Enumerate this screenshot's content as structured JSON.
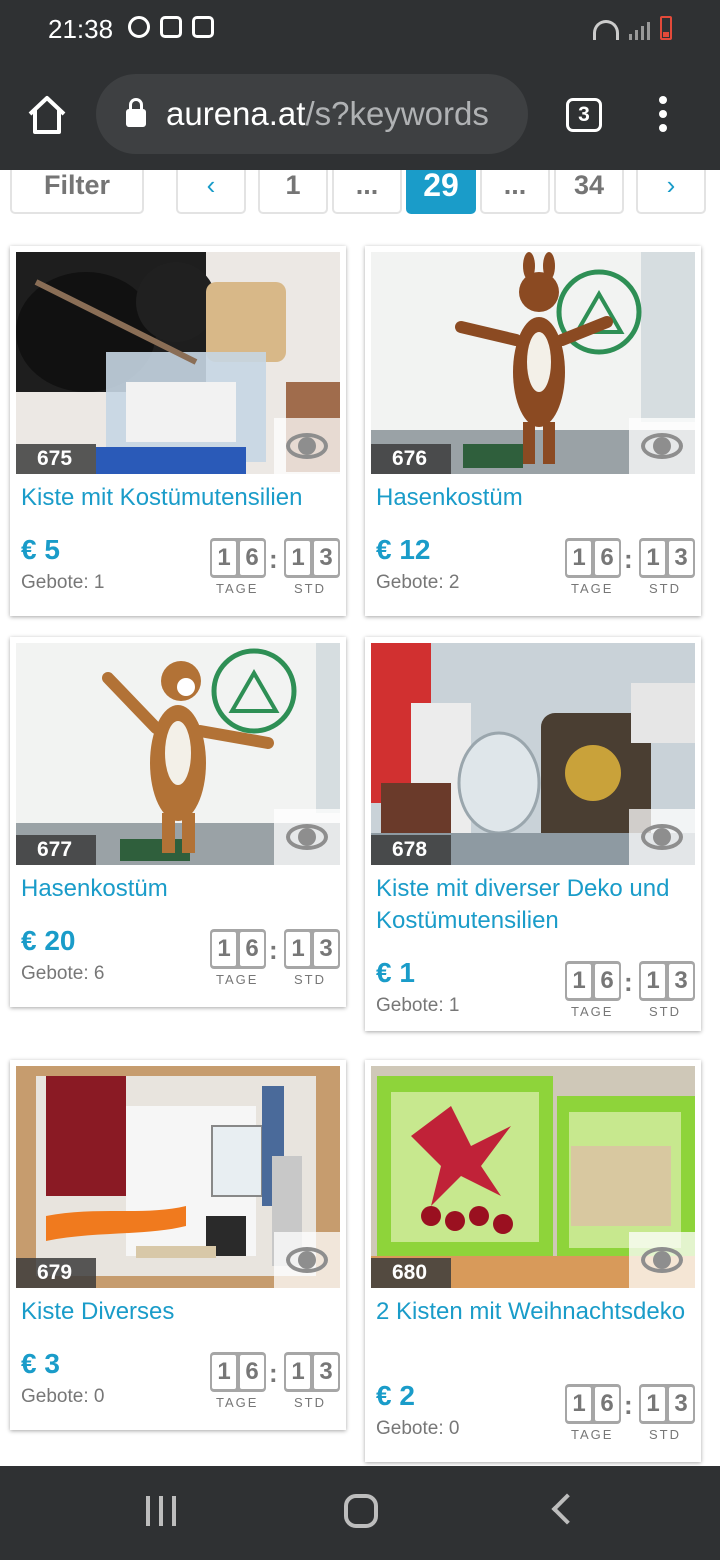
{
  "status_bar": {
    "time": "21:38"
  },
  "browser": {
    "url_domain": "aurena.at",
    "url_path": "/s?keywords",
    "tab_count": "3"
  },
  "pagination": {
    "filter_label": "Filter",
    "prev": "‹",
    "pages": [
      "1",
      "...",
      "29",
      "...",
      "34"
    ],
    "current": "29",
    "next": "›"
  },
  "timer_labels": {
    "days": "TAGE",
    "hours": "STD"
  },
  "cards": [
    {
      "lot": "675",
      "title": "Kiste mit Kostümutensilien",
      "price": "€ 5",
      "bids": "Gebote: 1",
      "days": [
        "1",
        "6"
      ],
      "hours": [
        "1",
        "3"
      ]
    },
    {
      "lot": "676",
      "title": "Hasenkostüm",
      "price": "€ 12",
      "bids": "Gebote: 2",
      "days": [
        "1",
        "6"
      ],
      "hours": [
        "1",
        "3"
      ]
    },
    {
      "lot": "677",
      "title": "Hasenkostüm",
      "price": "€ 20",
      "bids": "Gebote: 6",
      "days": [
        "1",
        "6"
      ],
      "hours": [
        "1",
        "3"
      ]
    },
    {
      "lot": "678",
      "title": "Kiste mit diverser Deko und Kostümutensilien",
      "price": "€ 1",
      "bids": "Gebote: 1",
      "days": [
        "1",
        "6"
      ],
      "hours": [
        "1",
        "3"
      ]
    },
    {
      "lot": "679",
      "title": "Kiste Diverses",
      "price": "€ 3",
      "bids": "Gebote: 0",
      "days": [
        "1",
        "6"
      ],
      "hours": [
        "1",
        "3"
      ]
    },
    {
      "lot": "680",
      "title": "2 Kisten mit Weihnachtsdeko",
      "price": "€ 2",
      "bids": "Gebote: 0",
      "days": [
        "1",
        "6"
      ],
      "hours": [
        "1",
        "3"
      ]
    }
  ],
  "colors": {
    "accent": "#1a9cc9",
    "chrome": "#2f3133",
    "text_muted": "#777777"
  }
}
